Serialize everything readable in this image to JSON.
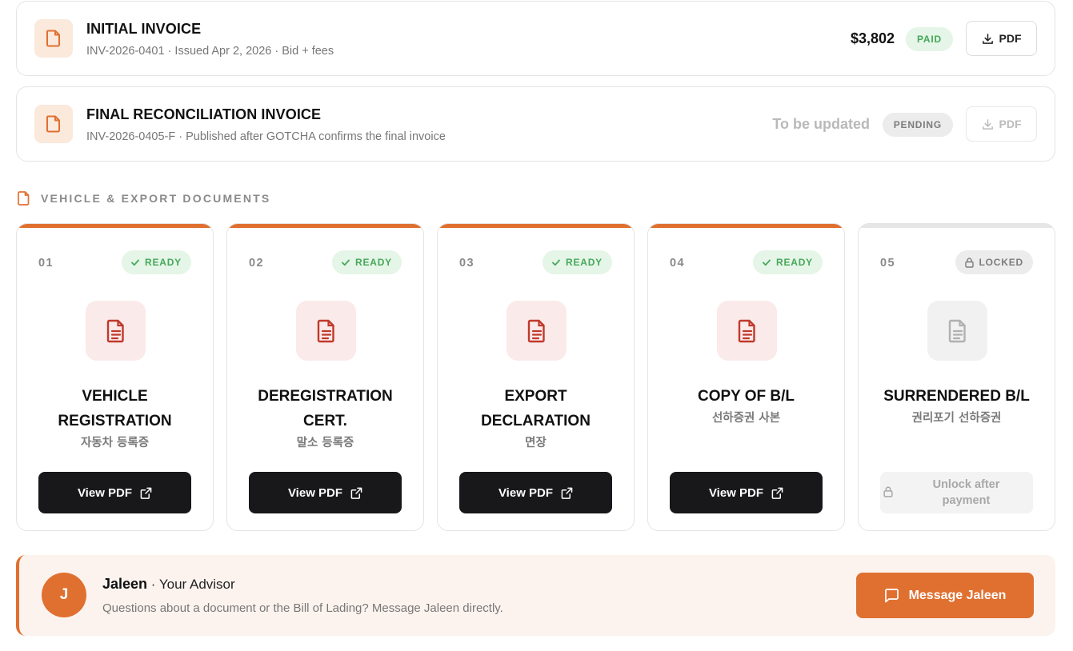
{
  "invoices": [
    {
      "title": "INITIAL INVOICE",
      "meta": "INV-2026-0401 · Issued Apr 2, 2026 · Bid + fees",
      "amount": "$3,802",
      "status": "PAID",
      "pdf_label": "PDF"
    },
    {
      "title": "FINAL RECONCILIATION INVOICE",
      "meta": "INV-2026-0405-F · Published after GOTCHA confirms the final invoice",
      "amount": "To be updated",
      "status": "PENDING",
      "pdf_label": "PDF"
    }
  ],
  "documents_section": {
    "label": "VEHICLE & EXPORT DOCUMENTS",
    "cards": [
      {
        "num": "01",
        "status": "READY",
        "title_line1": "VEHICLE",
        "title_line2": "REGISTRATION",
        "subtitle": "자동차 등록증",
        "button": "View PDF"
      },
      {
        "num": "02",
        "status": "READY",
        "title_line1": "DEREGISTRATION",
        "title_line2": "CERT.",
        "subtitle": "말소 등록증",
        "button": "View PDF"
      },
      {
        "num": "03",
        "status": "READY",
        "title_line1": "EXPORT",
        "title_line2": "DECLARATION",
        "subtitle": "면장",
        "button": "View PDF"
      },
      {
        "num": "04",
        "status": "READY",
        "title_line1": "COPY OF B/L",
        "title_line2": "",
        "subtitle": "선하증권 사본",
        "button": "View PDF"
      },
      {
        "num": "05",
        "status": "LOCKED",
        "title_line1": "SURRENDERED B/L",
        "title_line2": "",
        "subtitle": "권리포기 선하증권",
        "button_line1": "Unlock after",
        "button_line2": "payment"
      }
    ]
  },
  "advisor": {
    "initial": "J",
    "name": "Jaleen",
    "role": " · Your Advisor",
    "message": "Questions about a document or the Bill of Lading? Message Jaleen directly.",
    "button": "Message Jaleen"
  },
  "colors": {
    "accent": "#e07030",
    "ready_green": "#45a85a",
    "doc_red": "#c0392b",
    "dark_button": "#18181b"
  }
}
